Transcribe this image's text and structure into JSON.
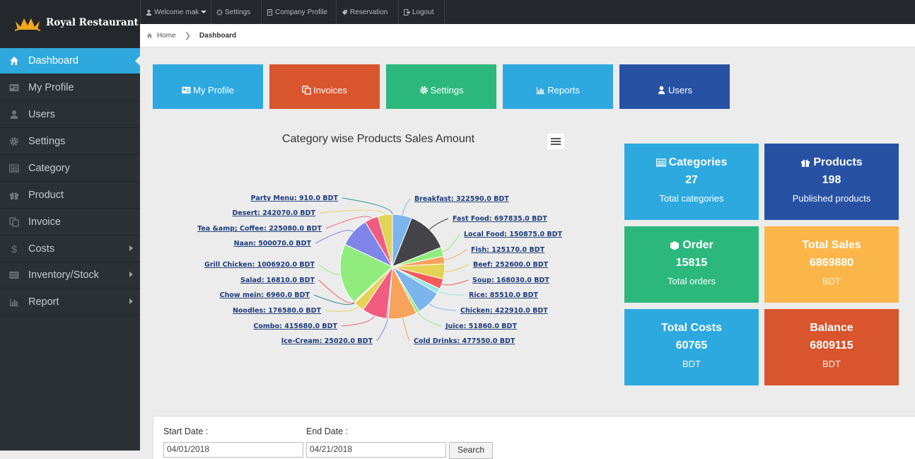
{
  "brand": {
    "name": "Royal Restaurant"
  },
  "topnav": [
    {
      "label": "Welcome mak",
      "icon": "user-icon"
    },
    {
      "label": "Settings",
      "icon": "gear-icon"
    },
    {
      "label": "Company Profile",
      "icon": "document-icon"
    },
    {
      "label": "Reservation",
      "icon": "tag-icon"
    },
    {
      "label": "Logout",
      "icon": "logout-icon"
    }
  ],
  "breadcrumb": {
    "home": "Home",
    "current": "Dashboard"
  },
  "sidebar": {
    "items": [
      {
        "label": "Dashboard",
        "icon": "home-icon",
        "active": true
      },
      {
        "label": "My Profile",
        "icon": "id-card-icon"
      },
      {
        "label": "Users",
        "icon": "user-icon"
      },
      {
        "label": "Settings",
        "icon": "gear-icon"
      },
      {
        "label": "Category",
        "icon": "list-icon"
      },
      {
        "label": "Product",
        "icon": "gift-icon"
      },
      {
        "label": "Invoice",
        "icon": "copy-icon"
      },
      {
        "label": "Costs",
        "icon": "dollar-icon",
        "submenu": true
      },
      {
        "label": "Inventory/Stock",
        "icon": "stack-icon",
        "submenu": true
      },
      {
        "label": "Report",
        "icon": "bar-chart-icon",
        "submenu": true
      }
    ]
  },
  "tiles": [
    {
      "label": "My Profile",
      "icon": "id-card-icon",
      "color": "#2ea9e0"
    },
    {
      "label": "Invoices",
      "icon": "copy-icon",
      "color": "#d9552d"
    },
    {
      "label": "Settings",
      "icon": "gear-icon",
      "color": "#2cb87d"
    },
    {
      "label": "Reports",
      "icon": "bar-chart-icon",
      "color": "#2ea9e0"
    },
    {
      "label": "Users",
      "icon": "user-icon",
      "color": "#2752a4"
    }
  ],
  "chart_data": {
    "type": "pie",
    "title": "Category wise Products Sales Amount",
    "slices": [
      {
        "label": "Breakfast: 322590.0 BDT",
        "value": 322590.0,
        "color": "#7cb5ec"
      },
      {
        "label": "Fast Food: 697835.0 BDT",
        "value": 697835.0,
        "color": "#434348"
      },
      {
        "label": "Local Food: 150875.0 BDT",
        "value": 150875.0,
        "color": "#90ed7d"
      },
      {
        "label": "Fish: 125170.0 BDT",
        "value": 125170.0,
        "color": "#f7a35c"
      },
      {
        "label": "Beef: 252600.0 BDT",
        "value": 252600.0,
        "color": "#e4d354"
      },
      {
        "label": "Soup: 168030.0 BDT",
        "value": 168030.0,
        "color": "#f45b5b"
      },
      {
        "label": "Rice: 85510.0 BDT",
        "value": 85510.0,
        "color": "#91e8e1"
      },
      {
        "label": "Chicken: 422910.0 BDT",
        "value": 422910.0,
        "color": "#7cb5ec"
      },
      {
        "label": "Juice: 51860.0 BDT",
        "value": 51860.0,
        "color": "#90ed7d"
      },
      {
        "label": "Cold Drinks: 477550.0 BDT",
        "value": 477550.0,
        "color": "#f7a35c"
      },
      {
        "label": "Ice-Cream: 25020.0 BDT",
        "value": 25020.0,
        "color": "#8085e9"
      },
      {
        "label": "Combo: 415680.0 BDT",
        "value": 415680.0,
        "color": "#f15c80"
      },
      {
        "label": "Noodles: 176580.0 BDT",
        "value": 176580.0,
        "color": "#e4d354"
      },
      {
        "label": "Chow mein: 6960.0 BDT",
        "value": 6960.0,
        "color": "#2b908f"
      },
      {
        "label": "Salad: 16810.0 BDT",
        "value": 16810.0,
        "color": "#f45b5b"
      },
      {
        "label": "Grill Chicken: 1006920.0 BDT",
        "value": 1006920.0,
        "color": "#90ed7d"
      },
      {
        "label": "Naan: 500070.0 BDT",
        "value": 500070.0,
        "color": "#8085e9"
      },
      {
        "label": "Tea &amp; Coffee: 225080.0 BDT",
        "value": 225080.0,
        "color": "#f15c80"
      },
      {
        "label": "Desert: 242070.0 BDT",
        "value": 242070.0,
        "color": "#e4d354"
      },
      {
        "label": "Party Menu: 910.0 BDT",
        "value": 910.0,
        "color": "#2b908f"
      }
    ]
  },
  "cards": [
    {
      "title": "Categories",
      "icon": "list-icon",
      "value": "27",
      "sub": "Total categories",
      "color": "#2ea9e0"
    },
    {
      "title": "Products",
      "icon": "gift-icon",
      "value": "198",
      "sub": "Published products",
      "color": "#2752a4"
    },
    {
      "title": "Order",
      "icon": "cube-icon",
      "value": "15815",
      "sub": "Total orders",
      "color": "#2cb87d"
    },
    {
      "title": "Total Sales",
      "value": "6869880",
      "sub": "BDT",
      "color": "#fbb64a"
    },
    {
      "title": "Total Costs",
      "value": "60765",
      "sub": "BDT",
      "color": "#2ea9e0"
    },
    {
      "title": "Balance",
      "value": "6809115",
      "sub": "BDT",
      "color": "#d9552d"
    }
  ],
  "filter": {
    "start_label": "Start Date :",
    "start_value": "04/01/2018",
    "end_label": "End Date :",
    "end_value": "04/21/2018",
    "search_label": "Search"
  }
}
